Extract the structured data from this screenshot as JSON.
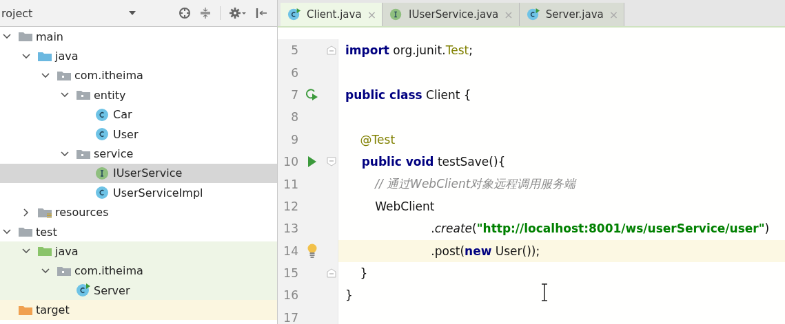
{
  "project_panel": {
    "title": "roject",
    "tree": [
      {
        "label": "main",
        "kind": "folder",
        "expanded": true,
        "selected": false,
        "children": [
          {
            "label": "java",
            "kind": "source-folder",
            "expanded": true,
            "selected": false,
            "children": [
              {
                "label": "com.itheima",
                "kind": "package",
                "expanded": true,
                "selected": false,
                "children": [
                  {
                    "label": "entity",
                    "kind": "package",
                    "expanded": true,
                    "selected": false,
                    "children": [
                      {
                        "label": "Car",
                        "kind": "class",
                        "selected": false
                      },
                      {
                        "label": "User",
                        "kind": "class",
                        "selected": false
                      }
                    ]
                  },
                  {
                    "label": "service",
                    "kind": "package",
                    "expanded": true,
                    "selected": false,
                    "children": [
                      {
                        "label": "IUserService",
                        "kind": "interface",
                        "selected": true
                      },
                      {
                        "label": "UserServiceImpl",
                        "kind": "class",
                        "selected": false
                      }
                    ]
                  }
                ]
              }
            ]
          },
          {
            "label": "resources",
            "kind": "resources-folder",
            "expanded": false,
            "selected": false
          }
        ]
      },
      {
        "label": "test",
        "kind": "folder",
        "expanded": true,
        "selected": false,
        "children": [
          {
            "label": "java",
            "kind": "test-folder",
            "expanded": true,
            "selected": false,
            "children": [
              {
                "label": "com.itheima",
                "kind": "package",
                "expanded": true,
                "selected": false,
                "children": [
                  {
                    "label": "Server",
                    "kind": "run-class",
                    "selected": false
                  }
                ]
              }
            ]
          }
        ]
      },
      {
        "label": "target",
        "kind": "excluded-folder",
        "selected": false
      }
    ]
  },
  "editor": {
    "tabs": [
      {
        "label": "Client.java",
        "kind": "run-class",
        "close": "×",
        "selected": true
      },
      {
        "label": "IUserService.java",
        "kind": "interface",
        "close": "×",
        "selected": false
      },
      {
        "label": "Server.java",
        "kind": "run-class",
        "close": "×",
        "selected": false
      }
    ],
    "lines": [
      {
        "number": "5",
        "kind": "plain",
        "fold_end": true,
        "current": false,
        "tokens": [
          {
            "text": "import",
            "kind": "keyword"
          },
          {
            "text": " org.junit.",
            "kind": "plain"
          },
          {
            "text": "Test",
            "kind": "type"
          },
          {
            "text": ";",
            "kind": "plain"
          }
        ]
      },
      {
        "number": "6",
        "kind": "plain",
        "current": false
      },
      {
        "number": "7",
        "kind": "run-class",
        "current": false,
        "tokens": [
          {
            "text": "public class",
            "kind": "keyword"
          },
          {
            "text": " Client {",
            "kind": "plain"
          }
        ]
      },
      {
        "number": "8",
        "kind": "plain",
        "current": false
      },
      {
        "number": "9",
        "kind": "plain",
        "current": false,
        "tokens": [
          {
            "text": "    @Test",
            "kind": "annotation"
          }
        ]
      },
      {
        "number": "10",
        "kind": "run",
        "fold_start": true,
        "current": false,
        "tokens": [
          {
            "text": "    public void",
            "kind": "keyword"
          },
          {
            "text": " testSave(){",
            "kind": "plain"
          }
        ]
      },
      {
        "number": "11",
        "kind": "plain",
        "current": false,
        "tokens": [
          {
            "text": "        // 通过WebClient对象远程调用服务端",
            "kind": "comment"
          }
        ]
      },
      {
        "number": "12",
        "kind": "plain",
        "current": false,
        "tokens": [
          {
            "text": "        WebClient",
            "kind": "plain"
          }
        ]
      },
      {
        "number": "13",
        "kind": "plain",
        "current": false,
        "tokens": [
          {
            "text": "                       .",
            "kind": "plain"
          },
          {
            "text": "create",
            "kind": "method"
          },
          {
            "text": "(",
            "kind": "plain"
          },
          {
            "text": "\"http://localhost:8001/ws/userService/user\"",
            "kind": "string"
          },
          {
            "text": ")",
            "kind": "plain"
          }
        ]
      },
      {
        "number": "14",
        "kind": "bulb",
        "current": true,
        "tokens": [
          {
            "text": "                       .post(",
            "kind": "plain"
          },
          {
            "text": "new",
            "kind": "keyword"
          },
          {
            "text": " User());",
            "kind": "plain"
          }
        ]
      },
      {
        "number": "15",
        "kind": "plain",
        "fold_end": true,
        "current": false,
        "tokens": [
          {
            "text": "    }",
            "kind": "plain"
          }
        ]
      },
      {
        "number": "16",
        "kind": "plain",
        "current": false,
        "tokens": [
          {
            "text": "}",
            "kind": "plain"
          }
        ]
      },
      {
        "number": "17",
        "kind": "plain",
        "current": false
      }
    ]
  }
}
